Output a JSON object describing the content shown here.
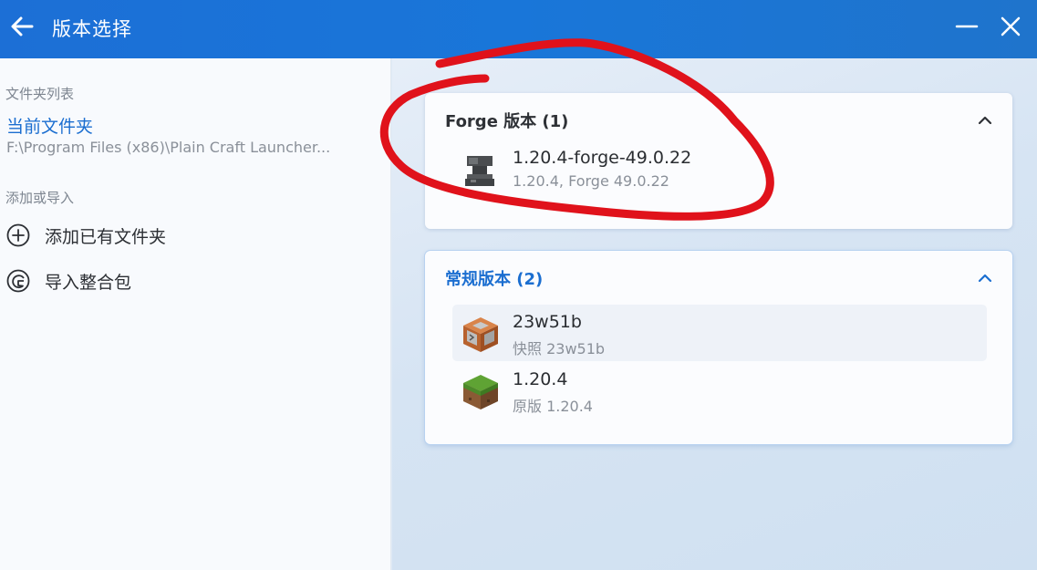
{
  "window": {
    "title": "版本选择",
    "back_icon": "arrow-left-icon",
    "minimize_icon": "minimize-icon",
    "close_icon": "close-icon"
  },
  "sidebar": {
    "folder_list_label": "文件夹列表",
    "current_folder": {
      "name": "当前文件夹",
      "path": "F:\\Program Files (x86)\\Plain Craft Launcher..."
    },
    "add_or_import_label": "添加或导入",
    "actions": [
      {
        "label": "添加已有文件夹",
        "icon": "add-circle-icon"
      },
      {
        "label": "导入整合包",
        "icon": "import-package-icon"
      }
    ]
  },
  "groups": [
    {
      "title": "Forge 版本 (1)",
      "expanded": true,
      "items": [
        {
          "name": "1.20.4-forge-49.0.22",
          "sub": "1.20.4, Forge 49.0.22",
          "icon": "anvil-icon"
        }
      ]
    },
    {
      "title": "常规版本 (2)",
      "expanded": true,
      "items": [
        {
          "name": "23w51b",
          "sub": "快照 23w51b",
          "icon": "command-block-icon"
        },
        {
          "name": "1.20.4",
          "sub": "原版 1.20.4",
          "icon": "grass-block-icon"
        }
      ]
    }
  ],
  "colors": {
    "titlebar": "#1c6fd6",
    "accent": "#1b6ed0",
    "annotation": "#e0121b"
  }
}
